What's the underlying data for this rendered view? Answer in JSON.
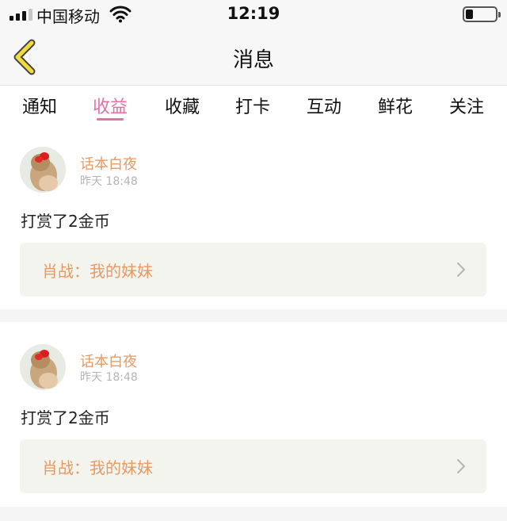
{
  "status_bar": {
    "carrier": "中国移动",
    "time": "12:19",
    "battery_level": 0.25,
    "signal_bars_filled": 3,
    "signal_bars_total": 4
  },
  "nav": {
    "title": "消息",
    "back_icon": "chevron-left-icon",
    "accent_color": "#f2dc3c"
  },
  "tabs": [
    {
      "label": "通知"
    },
    {
      "label": "收益"
    },
    {
      "label": "收藏"
    },
    {
      "label": "打卡"
    },
    {
      "label": "互动"
    },
    {
      "label": "鲜花"
    },
    {
      "label": "关注"
    }
  ],
  "active_tab_index": 1,
  "colors": {
    "active_tab": "#e46fa6",
    "username": "#e59a64",
    "link_text": "#e59a64",
    "link_background": "#f4f4ee",
    "timestamp": "#b4b4b4"
  },
  "messages": [
    {
      "user_name": "话本白夜",
      "time": "昨天 18:48",
      "text": "打赏了2金币",
      "link_label": "肖战：我的妹妹"
    },
    {
      "user_name": "话本白夜",
      "time": "昨天 18:48",
      "text": "打赏了2金币",
      "link_label": "肖战：我的妹妹"
    }
  ]
}
